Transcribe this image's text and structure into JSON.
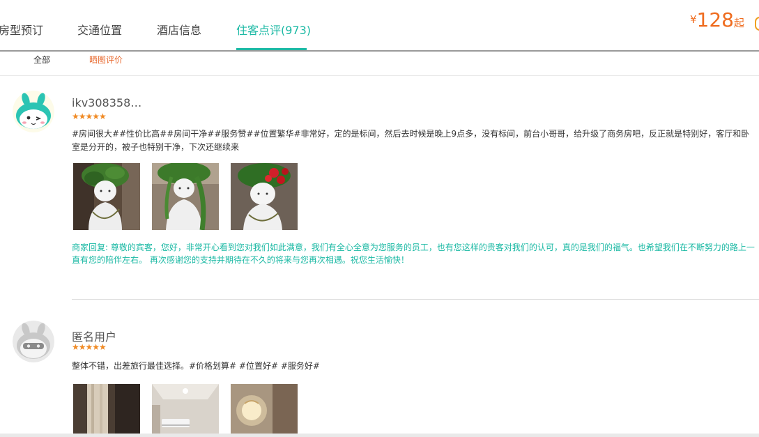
{
  "tabs": [
    {
      "label": "房型预订",
      "active": false
    },
    {
      "label": "交通位置",
      "active": false
    },
    {
      "label": "酒店信息",
      "active": false
    },
    {
      "label": "住客点评(973)",
      "active": true
    }
  ],
  "price": {
    "currency": "¥",
    "amount": "128",
    "suffix": "起"
  },
  "filters": {
    "all": "全部",
    "photo": "晒图评价"
  },
  "colors": {
    "accent": "#1bb9a4",
    "price": "#ef6c1f",
    "star": "#f08a24",
    "filter_active": "#e8692e"
  },
  "reviews": [
    {
      "username": "ikv308358…",
      "stars": "★★★★★",
      "rating": 5,
      "text": "#房间很大##性价比高##房间干净##服务赞##位置繁华#非常好，定的是标间，然后去时候是晚上9点多，没有标间，前台小哥哥，给升级了商务房吧，反正就是特别好，客厅和卧室是分开的，被子也特别干净，下次还继续来",
      "reply": "商家回复: 尊敬的宾客，您好，非常开心看到您对我们如此满意，我们有全心全意为您服务的员工，也有您这样的贵客对我们的认可，真的是我们的福气。也希望我们在不断努力的路上一直有您的陪伴左右。 再次感谢您的支持并期待在不久的将来与您再次相遇。祝您生活愉快！",
      "avatar_icon": "bunny-mascot-icon"
    },
    {
      "username": "匿名用户",
      "stars": "★★★★★",
      "rating": 5,
      "text": "整体不错，出差旅行最佳选择。#价格划算# #位置好# #服务好#",
      "avatar_icon": "anonymous-mascot-icon"
    }
  ]
}
